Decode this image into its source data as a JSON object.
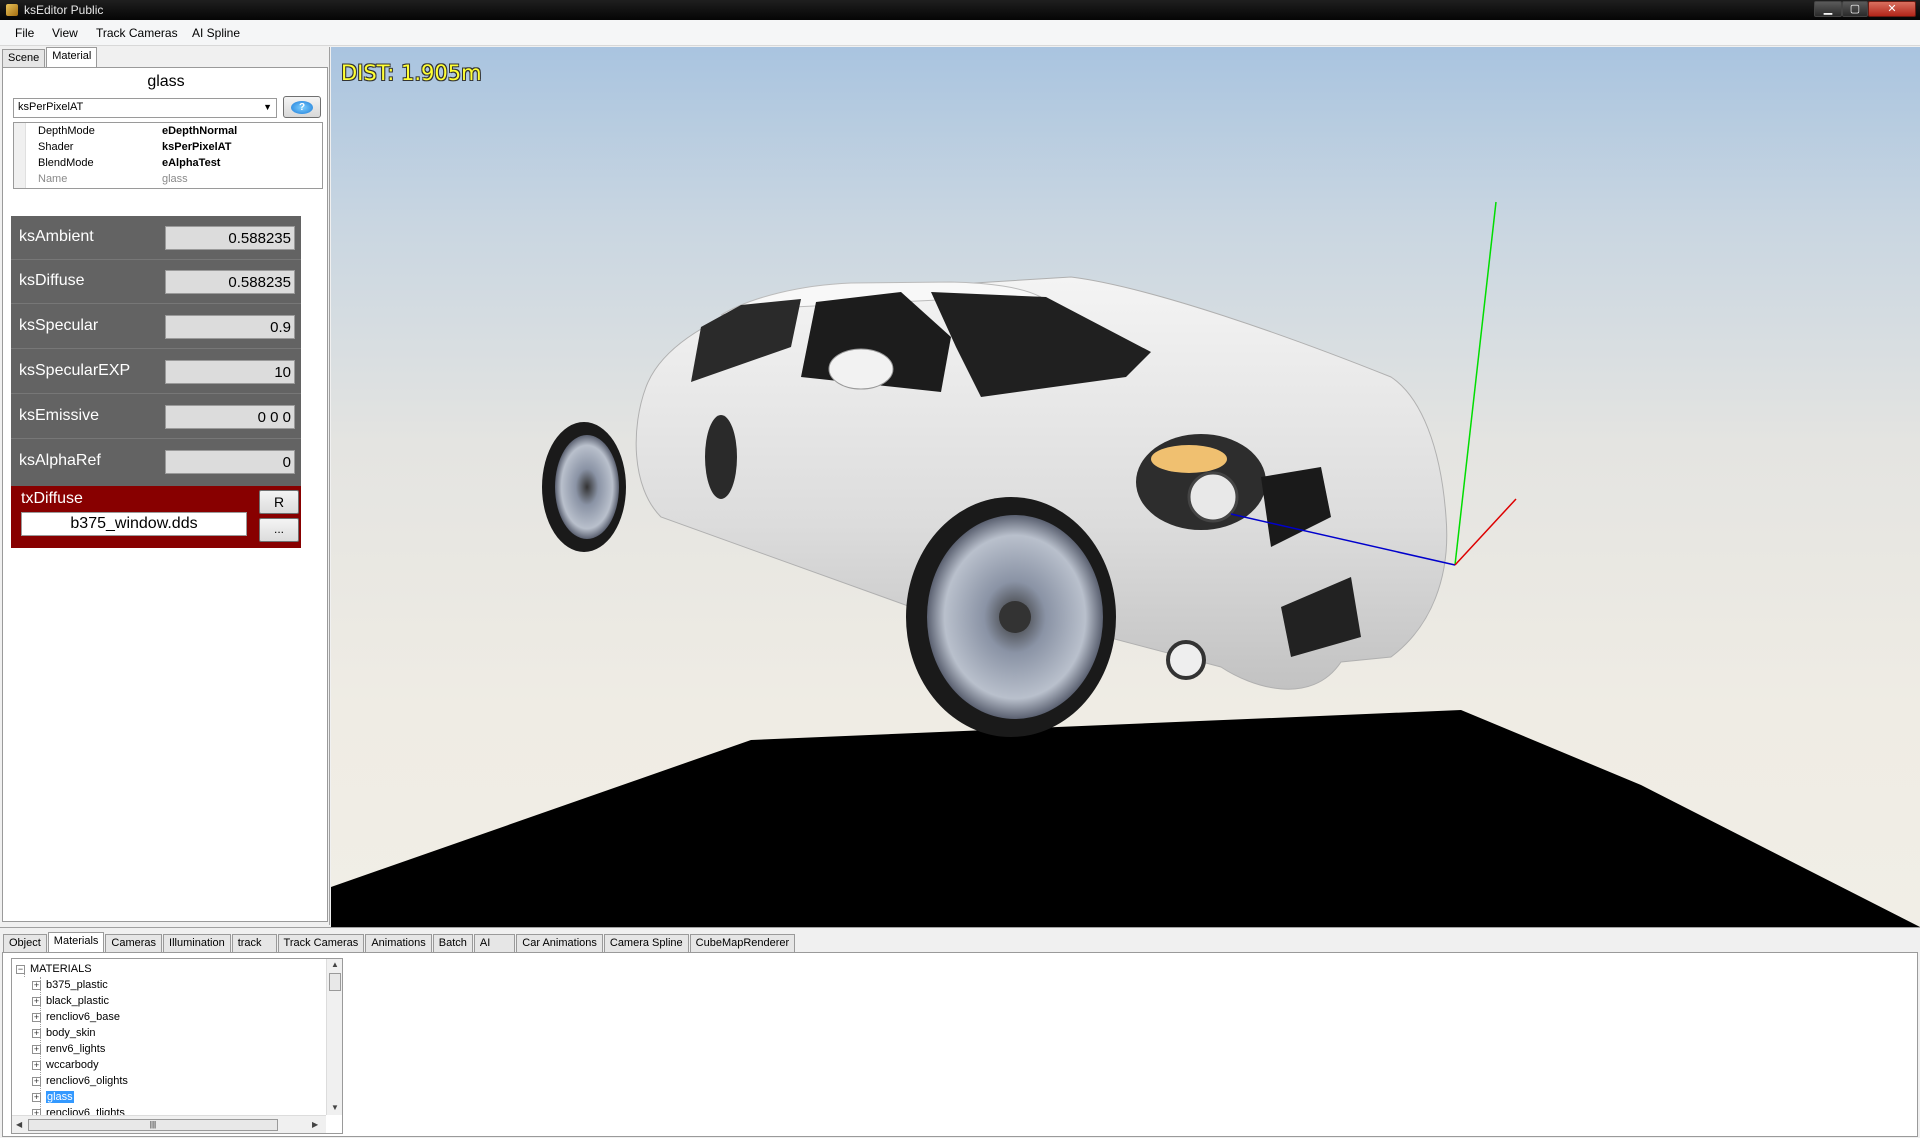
{
  "window": {
    "title": "ksEditor Public",
    "minimize": "▁",
    "maximize": "▢",
    "close": "✕"
  },
  "menu": [
    "File",
    "View",
    "Track Cameras",
    "AI Spline"
  ],
  "left_tabs": [
    "Scene",
    "Material"
  ],
  "material": {
    "name": "glass",
    "shader_selected": "ksPerPixelAT",
    "help_label": "?",
    "properties": [
      {
        "name": "DepthMode",
        "value": "eDepthNormal"
      },
      {
        "name": "Shader",
        "value": "ksPerPixelAT"
      },
      {
        "name": "BlendMode",
        "value": "eAlphaTest"
      },
      {
        "name": "Name",
        "value": "glass"
      }
    ],
    "params": [
      {
        "name": "ksAmbient",
        "value": "0.588235"
      },
      {
        "name": "ksDiffuse",
        "value": "0.588235"
      },
      {
        "name": "ksSpecular",
        "value": "0.9"
      },
      {
        "name": "ksSpecularEXP",
        "value": "10"
      },
      {
        "name": "ksEmissive",
        "value": "0 0 0"
      },
      {
        "name": "ksAlphaRef",
        "value": "0"
      }
    ],
    "texture": {
      "slot": "txDiffuse",
      "file": "b375_window.dds",
      "reset_label": "R",
      "browse_label": "..."
    }
  },
  "viewport": {
    "dist_readout": "DIST: 1.905m",
    "colors": {
      "axis_y": "#00dd00",
      "axis_x": "#dd0000",
      "axis_z": "#0000cc",
      "ground": "#000000",
      "readout": "#ffff33"
    }
  },
  "bottom_tabs": [
    "Object",
    "Materials",
    "Cameras",
    "Illumination",
    "track",
    "Track Cameras",
    "Animations",
    "Batch",
    "AI",
    "Car Animations",
    "Camera Spline",
    "CubeMapRenderer"
  ],
  "tree": {
    "root": "MATERIALS",
    "items": [
      "b375_plastic",
      "black_plastic",
      "rencliov6_base",
      "body_skin",
      "renv6_lights",
      "wccarbody",
      "rencliov6_olights",
      "glass",
      "rencliov6_tlights"
    ],
    "selected": "glass"
  }
}
